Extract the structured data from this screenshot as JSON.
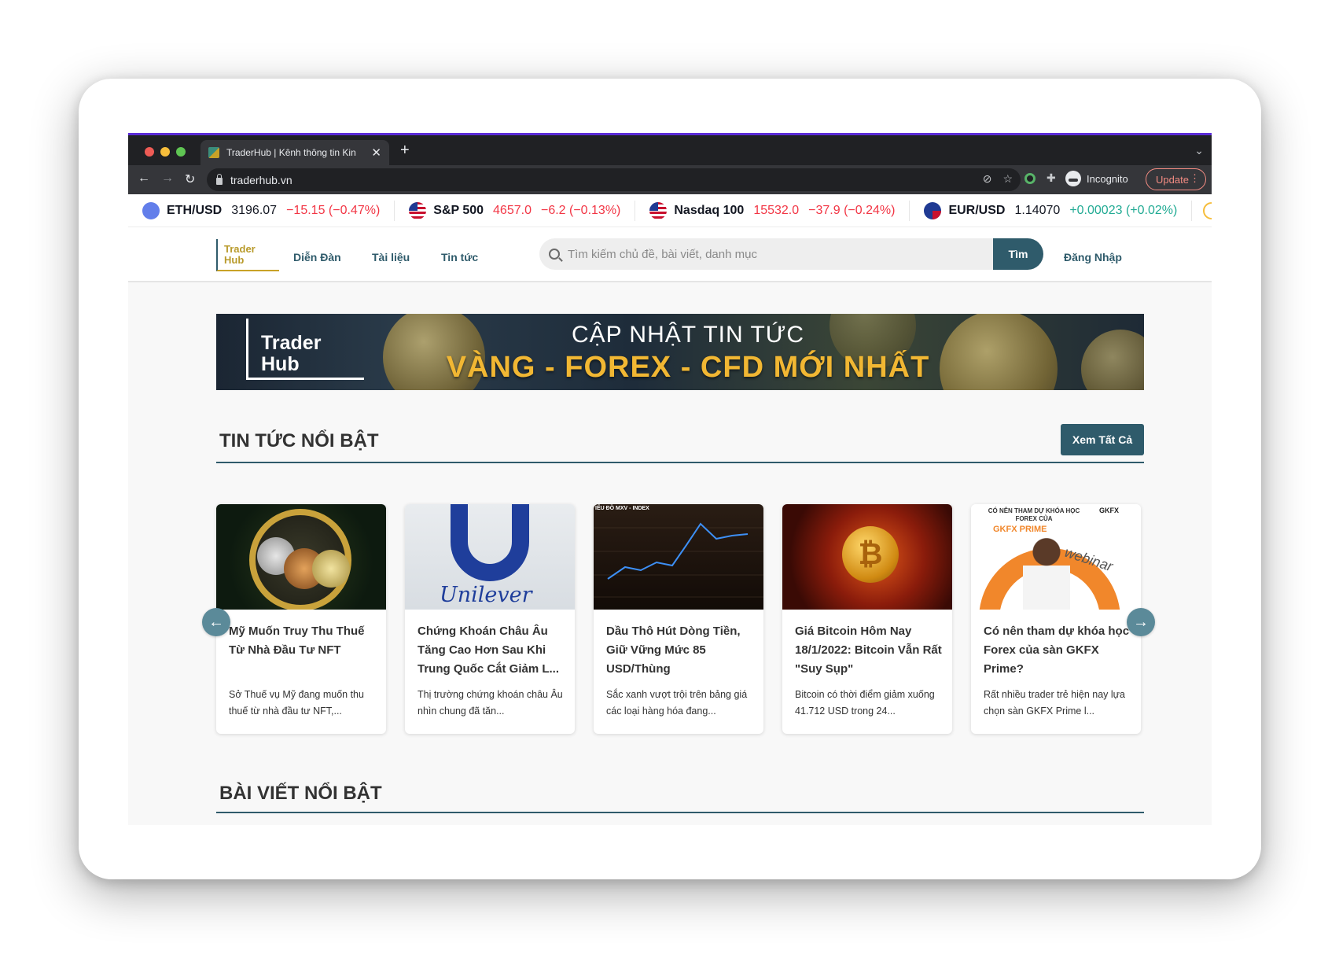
{
  "browser": {
    "tab_title": "TraderHub | Kênh thông tin Kin",
    "url": "traderhub.vn",
    "incognito_label": "Incognito",
    "update_label": "Update"
  },
  "ticker": [
    {
      "symbol": "ETH/USD",
      "price": "3196.07",
      "change": "−15.15 (−0.47%)",
      "direction": "down"
    },
    {
      "symbol": "S&P 500",
      "price": "4657.0",
      "change": "−6.2 (−0.13%)",
      "direction": "down"
    },
    {
      "symbol": "Nasdaq 100",
      "price": "15532.0",
      "change": "−37.9 (−0.24%)",
      "direction": "down"
    },
    {
      "symbol": "EUR/USD",
      "price": "1.14070",
      "change": "+0.00023 (+0.02%)",
      "direction": "up"
    }
  ],
  "header": {
    "logo_text": "Trader Hub",
    "nav": [
      "Diễn Đàn",
      "Tài liệu",
      "Tin tức"
    ],
    "search_placeholder": "Tìm kiếm chủ đề, bài viết, danh mục",
    "search_button": "Tìm",
    "login": "Đăng Nhập"
  },
  "banner": {
    "logo_text": "Trader Hub",
    "line1": "CẬP NHẬT TIN TỨC",
    "line2": "VÀNG - FOREX - CFD MỚI NHẤT"
  },
  "featured_news": {
    "title": "TIN TỨC NỔI BẬT",
    "view_all": "Xem Tất Cả",
    "cards": [
      {
        "title": "Mỹ Muốn Truy Thu Thuế Từ Nhà Đầu Tư NFT",
        "desc": "Sở Thuế vụ Mỹ đang muốn thu thuế từ nhà đầu tư NFT,..."
      },
      {
        "title": "Chứng Khoán Châu Âu Tăng Cao Hơn Sau Khi Trung Quốc Cắt Giảm L...",
        "desc": "Thị trường chứng khoán châu Âu nhìn chung đã tăn...",
        "image_text": "Unilever"
      },
      {
        "title": "Dầu Thô Hút Dòng Tiền, Giữ Vững Mức 85 USD/Thùng",
        "desc": "Sắc xanh vượt trội trên bảng giá các loại hàng hóa đang...",
        "image_text": "IỂU ĐỒ MXV - INDEX"
      },
      {
        "title": "Giá Bitcoin Hôm Nay 18/1/2022: Bitcoin Vẫn Rất \"Suy Sụp\"",
        "desc": "Bitcoin có thời điểm giảm xuống 41.712 USD trong 24..."
      },
      {
        "title": "Có nên tham dự khóa học Forex của sàn GKFX Prime?",
        "desc": "Rất nhiều trader trẻ hiện nay lựa chọn sàn GKFX Prime l...",
        "image_text": {
          "question": "CÓ NÊN THAM DỰ KHÓA HỌC FOREX CỦA",
          "brand": "GKFX PRIME",
          "logo": "GKFX",
          "script": "webinar"
        }
      }
    ]
  },
  "featured_posts": {
    "title": "BÀI VIẾT NỔI BẬT"
  },
  "colors": {
    "primary": "#2f5b6b",
    "gold": "#c9a227",
    "ticker_down": "#f23645",
    "ticker_up": "#22ab94"
  }
}
